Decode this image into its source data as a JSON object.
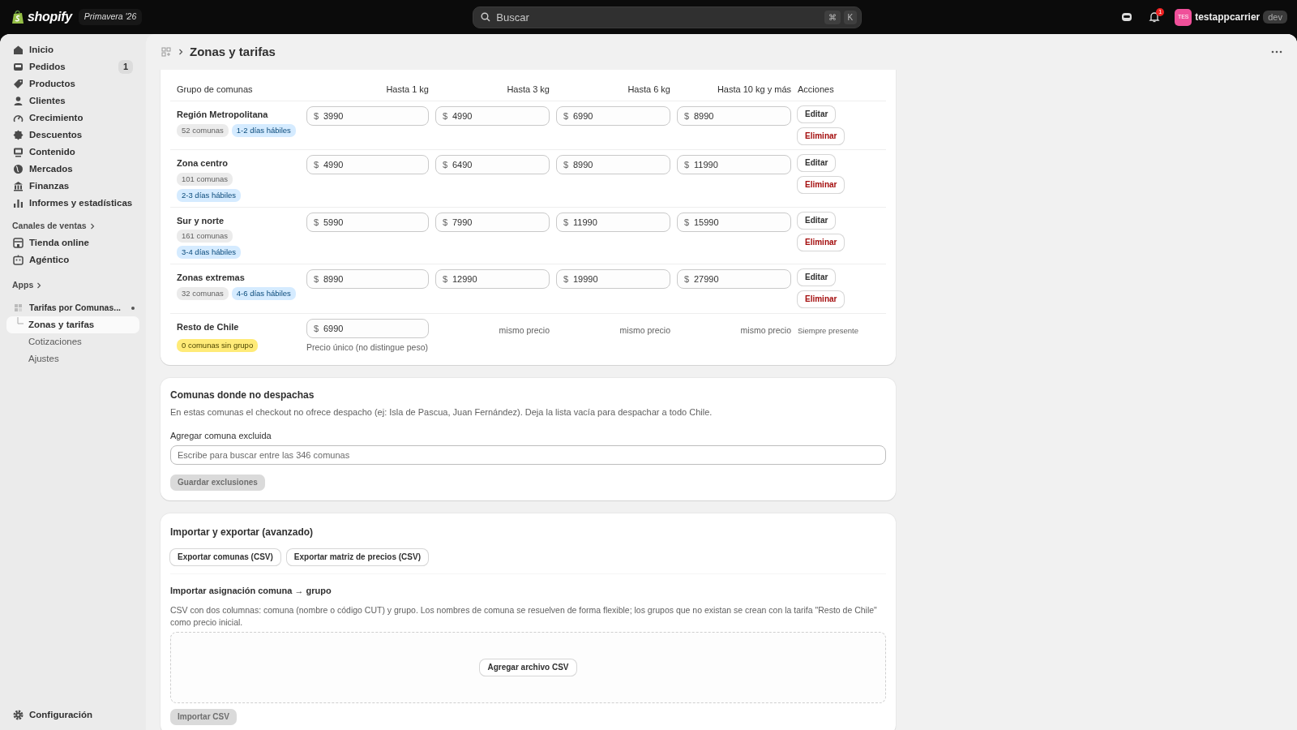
{
  "topbar": {
    "logo": "shopify",
    "edition": "Primavera '26",
    "search": {
      "placeholder": "Buscar",
      "shortcut": [
        "⌘",
        "K"
      ]
    },
    "notifications": "1",
    "avatar": "TES",
    "store": "testappcarrier",
    "store_badge": "dev"
  },
  "sidebar": {
    "main": [
      {
        "label": "Inicio",
        "selected": false
      },
      {
        "label": "Pedidos",
        "badge": "1",
        "selected": false
      },
      {
        "label": "Productos",
        "selected": false
      },
      {
        "label": "Clientes",
        "selected": false
      },
      {
        "label": "Crecimiento",
        "selected": false
      },
      {
        "label": "Descuentos",
        "selected": false
      },
      {
        "label": "Contenido",
        "selected": false
      },
      {
        "label": "Mercados",
        "selected": false
      },
      {
        "label": "Finanzas",
        "selected": false
      },
      {
        "label": "Informes y estadísticas",
        "selected": false
      }
    ],
    "channels_heading": "Canales de ventas",
    "channels": [
      {
        "label": "Tienda online",
        "selected": false
      },
      {
        "label": "Agéntico",
        "selected": false
      }
    ],
    "apps_heading": "Apps",
    "app": {
      "label": "Tarifas por Comunas...",
      "pinned": true
    },
    "app_pages": [
      {
        "label": "Zonas y tarifas",
        "selected": true
      },
      {
        "label": "Cotizaciones",
        "selected": false
      },
      {
        "label": "Ajustes",
        "selected": false
      }
    ],
    "footer": "Configuración"
  },
  "header": {
    "title": "Zonas y tarifas"
  },
  "zones": {
    "columns": [
      "Grupo de comunas",
      "Hasta 1 kg",
      "Hasta 3 kg",
      "Hasta 6 kg",
      "Hasta 10 kg y más",
      "Acciones"
    ],
    "rows": [
      {
        "name": "Región Metropolitana",
        "count": "52 comunas",
        "delivery": "1-2 días hábiles",
        "prices": [
          {
            "prefix": "$",
            "value": "3990"
          },
          {
            "prefix": "$",
            "value": "4990"
          },
          {
            "prefix": "$",
            "value": "6990"
          },
          {
            "prefix": "$",
            "value": "8990"
          }
        ],
        "actions": [
          "Editar",
          "Eliminar"
        ]
      },
      {
        "name": "Zona centro",
        "count": "101 comunas",
        "delivery": "2-3 días hábiles",
        "prices": [
          {
            "prefix": "$",
            "value": "4990"
          },
          {
            "prefix": "$",
            "value": "6490"
          },
          {
            "prefix": "$",
            "value": "8990"
          },
          {
            "prefix": "$",
            "value": "11990"
          }
        ],
        "actions": [
          "Editar",
          "Eliminar"
        ]
      },
      {
        "name": "Sur y norte",
        "count": "161 comunas",
        "delivery": "3-4 días hábiles",
        "prices": [
          {
            "prefix": "$",
            "value": "5990"
          },
          {
            "prefix": "$",
            "value": "7990"
          },
          {
            "prefix": "$",
            "value": "11990"
          },
          {
            "prefix": "$",
            "value": "15990"
          }
        ],
        "actions": [
          "Editar",
          "Eliminar"
        ]
      },
      {
        "name": "Zonas extremas",
        "count": "32 comunas",
        "delivery": "4-6 días hábiles",
        "prices": [
          {
            "prefix": "$",
            "value": "8990"
          },
          {
            "prefix": "$",
            "value": "12990"
          },
          {
            "prefix": "$",
            "value": "19990"
          },
          {
            "prefix": "$",
            "value": "27990"
          }
        ],
        "actions": [
          "Editar",
          "Eliminar"
        ]
      }
    ],
    "rest": {
      "name": "Resto de Chile",
      "badge": "0 comunas sin grupo",
      "price": {
        "prefix": "$",
        "value": "6990"
      },
      "note": "Precio único (no distingue peso)",
      "same_price": [
        "mismo precio",
        "mismo precio",
        "mismo precio"
      ],
      "action_note": "Siempre presente"
    }
  },
  "exclusions": {
    "title": "Comunas donde no despachas",
    "description": "En estas comunas el checkout no ofrece despacho (ej: Isla de Pascua, Juan Fernández). Deja la lista vacía para despachar a todo Chile.",
    "field_label": "Agregar comuna excluida",
    "placeholder": "Escribe para buscar entre las 346 comunas",
    "save": {
      "label": "Guardar exclusiones",
      "disabled": true
    }
  },
  "import_export": {
    "title": "Importar y exportar (avanzado)",
    "exports": [
      "Exportar comunas (CSV)",
      "Exportar matriz de precios (CSV)"
    ],
    "import_title": "Importar asignación comuna → grupo",
    "import_description": "CSV con dos columnas: comuna (nombre o código CUT) y grupo. Los nombres de comuna se resuelven de forma flexible; los grupos que no existan se crean con la tarifa \"Resto de Chile\" como precio inicial.",
    "dropzone_button": "Agregar archivo CSV",
    "import": {
      "label": "Importar CSV",
      "disabled": true
    }
  }
}
